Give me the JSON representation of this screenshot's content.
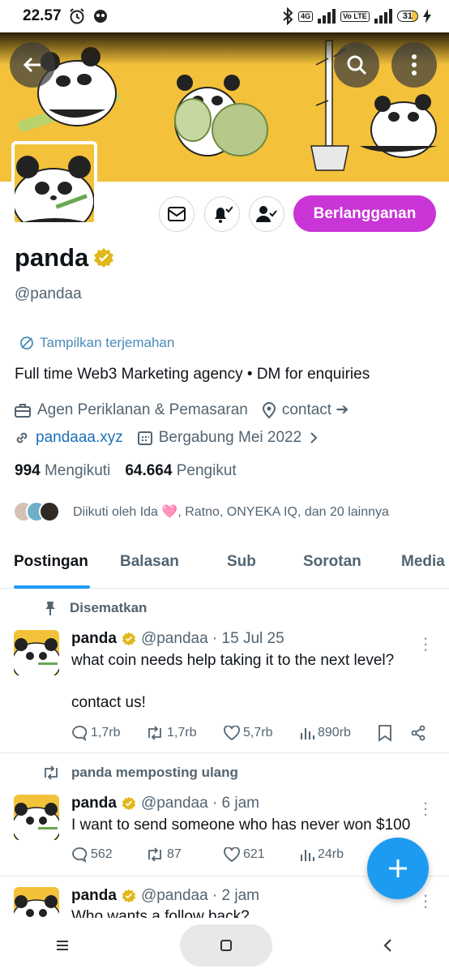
{
  "status_bar": {
    "time": "22.57",
    "net_a": "4G",
    "net_b": "Vo LTE",
    "battery": "31"
  },
  "profile": {
    "name": "panda",
    "handle": "@pandaa",
    "translate_label": "Tampilkan terjemahan",
    "bio": "Full time Web3 Marketing agency • DM for enquiries",
    "category": "Agen Periklanan & Pemasaran",
    "location": "contact ➔",
    "website": "pandaaa.xyz",
    "joined": "Bergabung Mei 2022",
    "following_count": "994",
    "following_label": "Mengikuti",
    "followers_count": "64.664",
    "followers_label": "Pengikut",
    "followed_by": "Diikuti oleh Ida 🩷, Ratno, ONYEKA IQ, dan 20 lainnya",
    "subscribe_label": "Berlangganan"
  },
  "tabs": [
    {
      "label": "Postingan",
      "active": true
    },
    {
      "label": "Balasan"
    },
    {
      "label": "Sub"
    },
    {
      "label": "Sorotan"
    },
    {
      "label": "Media"
    }
  ],
  "posts": [
    {
      "context": "Disematkan",
      "name": "panda",
      "handle_time": "@pandaa · 15 Jul 25",
      "text1": "what coin needs help taking it to the next level?",
      "text2": "contact us!",
      "replies": "1,7rb",
      "reposts": "1,7rb",
      "likes": "5,7rb",
      "views": "890rb"
    },
    {
      "context": "panda memposting ulang",
      "name": "panda",
      "handle_time": "@pandaa · 6 jam",
      "text1": "I want to send someone who has never won $100",
      "replies": "562",
      "reposts": "87",
      "likes": "621",
      "views": "24rb"
    },
    {
      "name": "panda",
      "handle_time": "@pandaa · 2 jam",
      "text1": "Who wants a follow back?"
    }
  ],
  "colors": {
    "accent": "#1d9bf0",
    "subscribe": "#c935d6",
    "banner": "#f3c13a",
    "verified": "#e2b719"
  }
}
